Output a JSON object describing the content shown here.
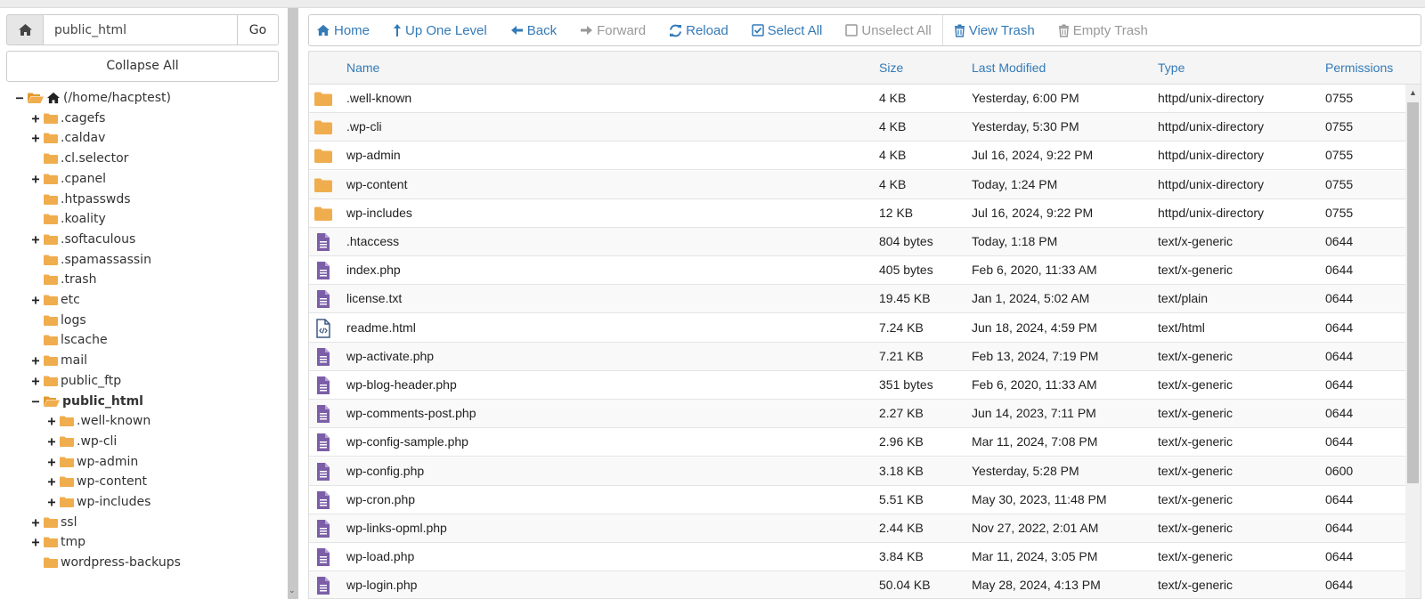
{
  "sidebar": {
    "path_input": "public_html",
    "go_label": "Go",
    "collapse_label": "Collapse All",
    "tree": [
      {
        "label": "(/home/hacptest)",
        "toggle": "−",
        "depth": 0,
        "home": true
      },
      {
        "label": ".cagefs",
        "toggle": "+",
        "depth": 1
      },
      {
        "label": ".caldav",
        "toggle": "+",
        "depth": 1
      },
      {
        "label": ".cl.selector",
        "toggle": "",
        "depth": 1
      },
      {
        "label": ".cpanel",
        "toggle": "+",
        "depth": 1
      },
      {
        "label": ".htpasswds",
        "toggle": "",
        "depth": 1
      },
      {
        "label": ".koality",
        "toggle": "",
        "depth": 1
      },
      {
        "label": ".softaculous",
        "toggle": "+",
        "depth": 1
      },
      {
        "label": ".spamassassin",
        "toggle": "",
        "depth": 1
      },
      {
        "label": ".trash",
        "toggle": "",
        "depth": 1
      },
      {
        "label": "etc",
        "toggle": "+",
        "depth": 1
      },
      {
        "label": "logs",
        "toggle": "",
        "depth": 1
      },
      {
        "label": "lscache",
        "toggle": "",
        "depth": 1
      },
      {
        "label": "mail",
        "toggle": "+",
        "depth": 1
      },
      {
        "label": "public_ftp",
        "toggle": "+",
        "depth": 1
      },
      {
        "label": "public_html",
        "toggle": "−",
        "depth": 1,
        "bold": true
      },
      {
        "label": ".well-known",
        "toggle": "+",
        "depth": 2
      },
      {
        "label": ".wp-cli",
        "toggle": "+",
        "depth": 2
      },
      {
        "label": "wp-admin",
        "toggle": "+",
        "depth": 2
      },
      {
        "label": "wp-content",
        "toggle": "+",
        "depth": 2
      },
      {
        "label": "wp-includes",
        "toggle": "+",
        "depth": 2
      },
      {
        "label": "ssl",
        "toggle": "+",
        "depth": 1
      },
      {
        "label": "tmp",
        "toggle": "+",
        "depth": 1
      },
      {
        "label": "wordpress-backups",
        "toggle": "",
        "depth": 1
      }
    ]
  },
  "toolbar": {
    "home": "Home",
    "up": "Up One Level",
    "back": "Back",
    "forward": "Forward",
    "reload": "Reload",
    "select_all": "Select All",
    "unselect_all": "Unselect All",
    "view_trash": "View Trash",
    "empty_trash": "Empty Trash"
  },
  "table": {
    "headers": {
      "name": "Name",
      "size": "Size",
      "modified": "Last Modified",
      "type": "Type",
      "perms": "Permissions"
    },
    "rows": [
      {
        "icon": "folder",
        "name": ".well-known",
        "size": "4 KB",
        "modified": "Yesterday, 6:00 PM",
        "type": "httpd/unix-directory",
        "perms": "0755"
      },
      {
        "icon": "folder",
        "name": ".wp-cli",
        "size": "4 KB",
        "modified": "Yesterday, 5:30 PM",
        "type": "httpd/unix-directory",
        "perms": "0755"
      },
      {
        "icon": "folder",
        "name": "wp-admin",
        "size": "4 KB",
        "modified": "Jul 16, 2024, 9:22 PM",
        "type": "httpd/unix-directory",
        "perms": "0755"
      },
      {
        "icon": "folder",
        "name": "wp-content",
        "size": "4 KB",
        "modified": "Today, 1:24 PM",
        "type": "httpd/unix-directory",
        "perms": "0755"
      },
      {
        "icon": "folder",
        "name": "wp-includes",
        "size": "12 KB",
        "modified": "Jul 16, 2024, 9:22 PM",
        "type": "httpd/unix-directory",
        "perms": "0755"
      },
      {
        "icon": "file",
        "name": ".htaccess",
        "size": "804 bytes",
        "modified": "Today, 1:18 PM",
        "type": "text/x-generic",
        "perms": "0644"
      },
      {
        "icon": "file",
        "name": "index.php",
        "size": "405 bytes",
        "modified": "Feb 6, 2020, 11:33 AM",
        "type": "text/x-generic",
        "perms": "0644"
      },
      {
        "icon": "file",
        "name": "license.txt",
        "size": "19.45 KB",
        "modified": "Jan 1, 2024, 5:02 AM",
        "type": "text/plain",
        "perms": "0644"
      },
      {
        "icon": "html",
        "name": "readme.html",
        "size": "7.24 KB",
        "modified": "Jun 18, 2024, 4:59 PM",
        "type": "text/html",
        "perms": "0644"
      },
      {
        "icon": "file",
        "name": "wp-activate.php",
        "size": "7.21 KB",
        "modified": "Feb 13, 2024, 7:19 PM",
        "type": "text/x-generic",
        "perms": "0644"
      },
      {
        "icon": "file",
        "name": "wp-blog-header.php",
        "size": "351 bytes",
        "modified": "Feb 6, 2020, 11:33 AM",
        "type": "text/x-generic",
        "perms": "0644"
      },
      {
        "icon": "file",
        "name": "wp-comments-post.php",
        "size": "2.27 KB",
        "modified": "Jun 14, 2023, 7:11 PM",
        "type": "text/x-generic",
        "perms": "0644"
      },
      {
        "icon": "file",
        "name": "wp-config-sample.php",
        "size": "2.96 KB",
        "modified": "Mar 11, 2024, 7:08 PM",
        "type": "text/x-generic",
        "perms": "0644"
      },
      {
        "icon": "file",
        "name": "wp-config.php",
        "size": "3.18 KB",
        "modified": "Yesterday, 5:28 PM",
        "type": "text/x-generic",
        "perms": "0600"
      },
      {
        "icon": "file",
        "name": "wp-cron.php",
        "size": "5.51 KB",
        "modified": "May 30, 2023, 11:48 PM",
        "type": "text/x-generic",
        "perms": "0644"
      },
      {
        "icon": "file",
        "name": "wp-links-opml.php",
        "size": "2.44 KB",
        "modified": "Nov 27, 2022, 2:01 AM",
        "type": "text/x-generic",
        "perms": "0644"
      },
      {
        "icon": "file",
        "name": "wp-load.php",
        "size": "3.84 KB",
        "modified": "Mar 11, 2024, 3:05 PM",
        "type": "text/x-generic",
        "perms": "0644"
      },
      {
        "icon": "file",
        "name": "wp-login.php",
        "size": "50.04 KB",
        "modified": "May 28, 2024, 4:13 PM",
        "type": "text/x-generic",
        "perms": "0644"
      }
    ]
  },
  "colors": {
    "accent": "#337ab7",
    "folder": "#f0ad4e",
    "file": "#7b5ea7",
    "disabled": "#999999"
  }
}
